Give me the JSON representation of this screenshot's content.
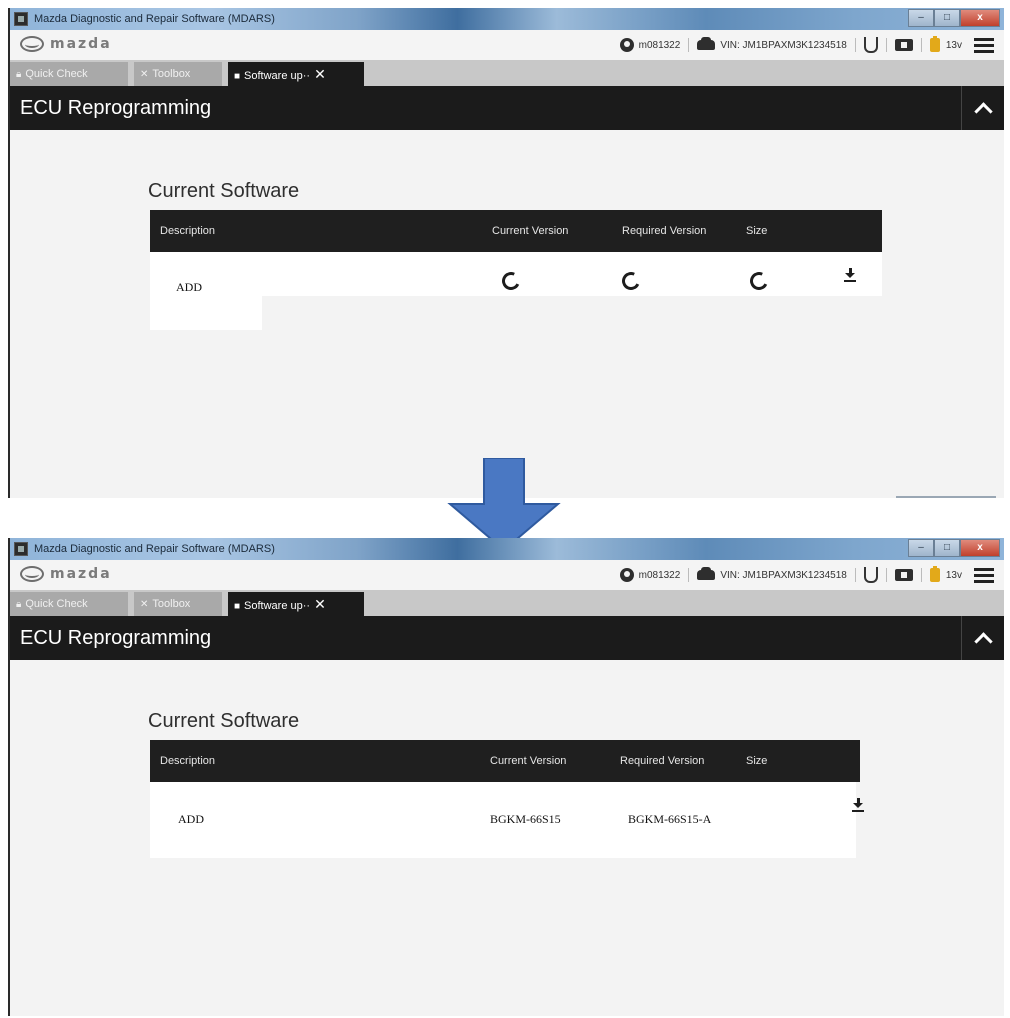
{
  "window": {
    "title": "Mazda Diagnostic and Repair Software (MDARS)",
    "minimize": "–",
    "maximize": "□",
    "close": "x"
  },
  "header": {
    "brand": "mazda",
    "user": "m081322",
    "vin": "VIN: JM1BPAXM3K1234518",
    "voltage": "13v"
  },
  "tabs": {
    "quick_check": "Quick Check",
    "toolbox": "Toolbox",
    "software_update": "Software up··",
    "close_glyph": "✕"
  },
  "section": {
    "title": "ECU Reprogramming"
  },
  "current_software": {
    "title": "Current Software",
    "columns": {
      "description": "Description",
      "current_version": "Current Version",
      "required_version": "Required Version",
      "size": "Size"
    }
  },
  "states": {
    "before": {
      "row": {
        "description": "ADD",
        "current_version": "",
        "required_version": "",
        "size": ""
      },
      "loading_icons": [
        "spinner-icon",
        "spinner-icon",
        "spinner-icon"
      ]
    },
    "after": {
      "row": {
        "description": "ADD",
        "current_version": "BGKM-66S15",
        "required_version": "BGKM-66S15-A",
        "size": ""
      }
    }
  },
  "colors": {
    "header_dark": "#1b1b1b",
    "tab_inactive": "#a9a9a9",
    "arrow_fill": "#4a78c3",
    "battery": "#e2a91a"
  }
}
